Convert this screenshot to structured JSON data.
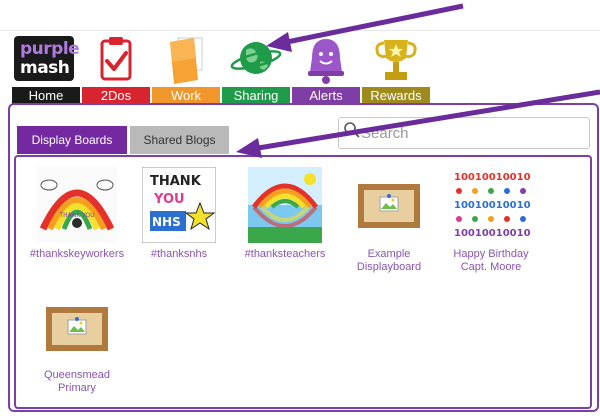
{
  "nav": {
    "logo": {
      "line1": "purple",
      "line2": "mash"
    },
    "items": [
      {
        "id": "home",
        "label": "Home",
        "color": "#1a1a1a"
      },
      {
        "id": "2dos",
        "label": "2Dos",
        "color": "#d7242f"
      },
      {
        "id": "work",
        "label": "Work",
        "color": "#f0962a"
      },
      {
        "id": "sharing",
        "label": "Sharing",
        "color": "#1f9b4a"
      },
      {
        "id": "alerts",
        "label": "Alerts",
        "color": "#7f3ea6"
      },
      {
        "id": "rewards",
        "label": "Rewards",
        "color": "#9f8a1c"
      }
    ]
  },
  "tabs": {
    "display_boards": "Display Boards",
    "shared_blogs": "Shared Blogs"
  },
  "search": {
    "placeholder": "Search"
  },
  "boards": [
    {
      "label": "#thankskeyworkers"
    },
    {
      "label": "#thanksnhs"
    },
    {
      "label": "#thanksteachers"
    },
    {
      "label": "Example Displayboard"
    },
    {
      "label": "Happy Birthday Capt. Moore"
    },
    {
      "label": "Queensmead Primary"
    }
  ],
  "colors": {
    "accent": "#7429a0",
    "arrow": "#6a2c9a"
  }
}
